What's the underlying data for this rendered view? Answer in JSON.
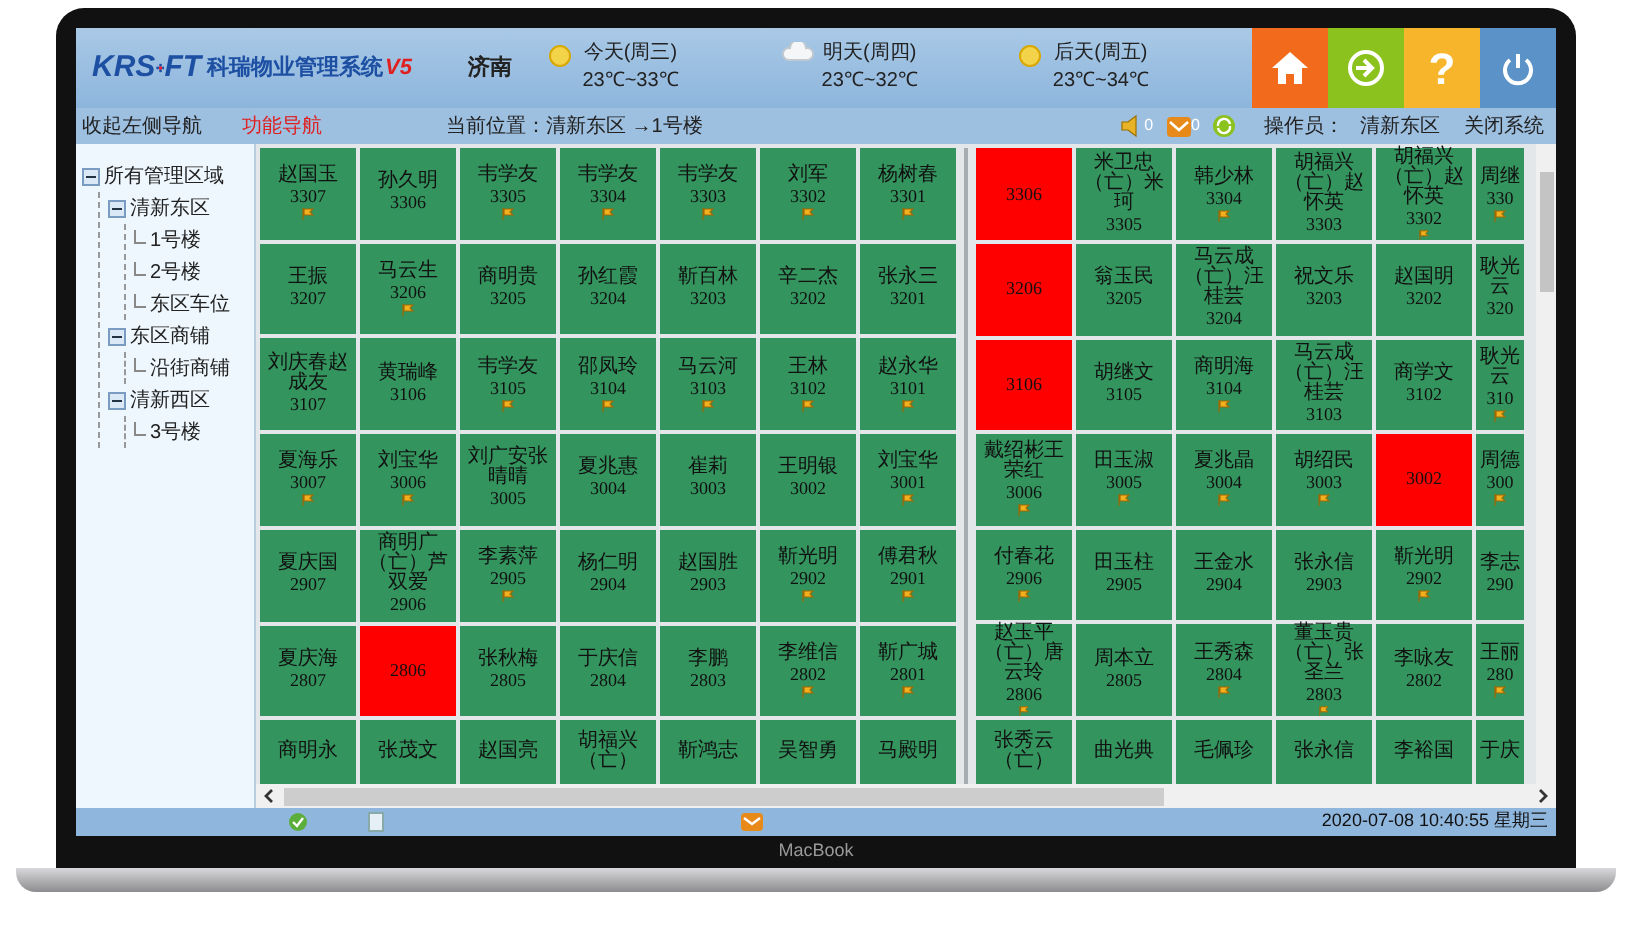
{
  "header": {
    "logo": {
      "letters_left": "KRS",
      "letters_right": "FT",
      "title": "科瑞物业管理系统",
      "version": "V5"
    },
    "city": "济南",
    "weather": [
      {
        "day": "今天(周三)",
        "temp": "23℃~33℃",
        "kind": "sunny"
      },
      {
        "day": "明天(周四)",
        "temp": "23℃~32℃",
        "kind": "cloudy"
      },
      {
        "day": "后天(周五)",
        "temp": "23℃~34℃",
        "kind": "sunny"
      }
    ],
    "buttons": [
      {
        "kind": "home"
      },
      {
        "kind": "login"
      },
      {
        "kind": "help",
        "label": "?"
      },
      {
        "kind": "power"
      }
    ]
  },
  "nav": {
    "collapse": "收起左侧导航",
    "function_nav": "功能导航",
    "location": "当前位置：清新东区 →1号楼",
    "alerts": [
      {
        "kind": "sound",
        "count": "0"
      },
      {
        "kind": "mail",
        "count": "0"
      },
      {
        "kind": "refresh"
      }
    ],
    "operator_label": "操作员：",
    "operator": "清新东区",
    "close": "关闭系统"
  },
  "tree": [
    {
      "label": "所有管理区域",
      "expanded": true,
      "children": [
        {
          "label": "清新东区",
          "expanded": true,
          "children": [
            {
              "label": "1号楼"
            },
            {
              "label": "2号楼"
            },
            {
              "label": "东区车位"
            }
          ]
        },
        {
          "label": "东区商铺",
          "expanded": true,
          "children": [
            {
              "label": "沿街商铺"
            }
          ]
        },
        {
          "label": "清新西区",
          "expanded": true,
          "children": [
            {
              "label": "3号楼"
            }
          ]
        }
      ]
    }
  ],
  "grid": {
    "blocks": [
      {
        "rows": [
          [
            {
              "name": "赵国玉",
              "number": "3307",
              "alert": false,
              "flag": true
            },
            {
              "name": "孙久明",
              "number": "3306",
              "alert": false,
              "flag": false
            },
            {
              "name": "韦学友",
              "number": "3305",
              "alert": false,
              "flag": true
            },
            {
              "name": "韦学友",
              "number": "3304",
              "alert": false,
              "flag": true
            },
            {
              "name": "韦学友",
              "number": "3303",
              "alert": false,
              "flag": true
            },
            {
              "name": "刘军",
              "number": "3302",
              "alert": false,
              "flag": true
            },
            {
              "name": "杨树春",
              "number": "3301",
              "alert": false,
              "flag": true
            }
          ],
          [
            {
              "name": "王振",
              "number": "3207",
              "alert": false,
              "flag": false
            },
            {
              "name": "马云生",
              "number": "3206",
              "alert": false,
              "flag": true
            },
            {
              "name": "商明贵",
              "number": "3205",
              "alert": false,
              "flag": false
            },
            {
              "name": "孙红霞",
              "number": "3204",
              "alert": false,
              "flag": false
            },
            {
              "name": "靳百林",
              "number": "3203",
              "alert": false,
              "flag": false
            },
            {
              "name": "辛二杰",
              "number": "3202",
              "alert": false,
              "flag": false
            },
            {
              "name": "张永三",
              "number": "3201",
              "alert": false,
              "flag": false
            }
          ],
          [
            {
              "name": "刘庆春赵成友",
              "number": "3107",
              "alert": false,
              "flag": false
            },
            {
              "name": "黄瑞峰",
              "number": "3106",
              "alert": false,
              "flag": false
            },
            {
              "name": "韦学友",
              "number": "3105",
              "alert": false,
              "flag": true
            },
            {
              "name": "邵凤玲",
              "number": "3104",
              "alert": false,
              "flag": true
            },
            {
              "name": "马云河",
              "number": "3103",
              "alert": false,
              "flag": true
            },
            {
              "name": "王林",
              "number": "3102",
              "alert": false,
              "flag": true
            },
            {
              "name": "赵永华",
              "number": "3101",
              "alert": false,
              "flag": true
            }
          ],
          [
            {
              "name": "夏海乐",
              "number": "3007",
              "alert": false,
              "flag": true
            },
            {
              "name": "刘宝华",
              "number": "3006",
              "alert": false,
              "flag": true
            },
            {
              "name": "刘广安张晴晴",
              "number": "3005",
              "alert": false,
              "flag": false
            },
            {
              "name": "夏兆惠",
              "number": "3004",
              "alert": false,
              "flag": false
            },
            {
              "name": "崔莉",
              "number": "3003",
              "alert": false,
              "flag": false
            },
            {
              "name": "王明银",
              "number": "3002",
              "alert": false,
              "flag": false
            },
            {
              "name": "刘宝华",
              "number": "3001",
              "alert": false,
              "flag": true
            }
          ],
          [
            {
              "name": "夏庆国",
              "number": "2907",
              "alert": false,
              "flag": false
            },
            {
              "name": "商明广（亡）芦双爱",
              "number": "2906",
              "alert": false,
              "flag": false
            },
            {
              "name": "李素萍",
              "number": "2905",
              "alert": false,
              "flag": true
            },
            {
              "name": "杨仁明",
              "number": "2904",
              "alert": false,
              "flag": false
            },
            {
              "name": "赵国胜",
              "number": "2903",
              "alert": false,
              "flag": false
            },
            {
              "name": "靳光明",
              "number": "2902",
              "alert": false,
              "flag": true
            },
            {
              "name": "傅君秋",
              "number": "2901",
              "alert": false,
              "flag": true
            }
          ],
          [
            {
              "name": "夏庆海",
              "number": "2807",
              "alert": false,
              "flag": false
            },
            {
              "number": "2806",
              "alert": true,
              "flag": false
            },
            {
              "name": "张秋梅",
              "number": "2805",
              "alert": false,
              "flag": false
            },
            {
              "name": "于庆信",
              "number": "2804",
              "alert": false,
              "flag": false
            },
            {
              "name": "李鹏",
              "number": "2803",
              "alert": false,
              "flag": false
            },
            {
              "name": "李维信",
              "number": "2802",
              "alert": false,
              "flag": true
            },
            {
              "name": "靳广城",
              "number": "2801",
              "alert": false,
              "flag": true
            }
          ],
          [
            {
              "name": "商明永",
              "alert": false,
              "flag": false
            },
            {
              "name": "张茂文",
              "alert": false,
              "flag": false
            },
            {
              "name": "赵国亮",
              "alert": false,
              "flag": false
            },
            {
              "name": "胡福兴（亡）",
              "alert": false,
              "flag": false
            },
            {
              "name": "靳鸿志",
              "alert": false,
              "flag": false
            },
            {
              "name": "吴智勇",
              "alert": false,
              "flag": false
            },
            {
              "name": "马殿明",
              "alert": false,
              "flag": false
            }
          ]
        ]
      },
      {
        "rows": [
          [
            {
              "kind": "full",
              "number": "3306",
              "alert": true,
              "flag": false
            },
            {
              "kind": "full",
              "name": "米卫忠（亡）米珂",
              "number": "3305",
              "alert": false,
              "flag": false
            },
            {
              "kind": "full",
              "name": "韩少林",
              "number": "3304",
              "alert": false,
              "flag": true
            },
            {
              "kind": "full",
              "name": "胡福兴（亡）赵怀英",
              "number": "3303",
              "alert": false,
              "flag": false
            },
            {
              "kind": "full",
              "name": "胡福兴（亡）赵怀英",
              "number": "3302",
              "alert": false,
              "flag": true
            },
            {
              "kind": "partial",
              "name": "周继",
              "number": "330",
              "alert": false,
              "flag": true
            }
          ],
          [
            {
              "kind": "full",
              "number": "3206",
              "alert": true,
              "flag": false
            },
            {
              "kind": "full",
              "name": "翁玉民",
              "number": "3205",
              "alert": false,
              "flag": false
            },
            {
              "kind": "full",
              "name": "马云成（亡）汪桂芸",
              "number": "3204",
              "alert": false,
              "flag": false
            },
            {
              "kind": "full",
              "name": "祝文乐",
              "number": "3203",
              "alert": false,
              "flag": false
            },
            {
              "kind": "full",
              "name": "赵国明",
              "number": "3202",
              "alert": false,
              "flag": false
            },
            {
              "kind": "partial",
              "name": "耿光云",
              "number": "320",
              "alert": false,
              "flag": false
            }
          ],
          [
            {
              "kind": "full",
              "number": "3106",
              "alert": true,
              "flag": false
            },
            {
              "kind": "full",
              "name": "胡继文",
              "number": "3105",
              "alert": false,
              "flag": false
            },
            {
              "kind": "full",
              "name": "商明海",
              "number": "3104",
              "alert": false,
              "flag": true
            },
            {
              "kind": "full",
              "name": "马云成（亡）汪桂芸",
              "number": "3103",
              "alert": false,
              "flag": false
            },
            {
              "kind": "full",
              "name": "商学文",
              "number": "3102",
              "alert": false,
              "flag": false
            },
            {
              "kind": "partial",
              "name": "耿光云",
              "number": "310",
              "alert": false,
              "flag": true
            }
          ],
          [
            {
              "kind": "full",
              "name": "戴绍彬王荣红",
              "number": "3006",
              "alert": false,
              "flag": true
            },
            {
              "kind": "full",
              "name": "田玉淑",
              "number": "3005",
              "alert": false,
              "flag": true
            },
            {
              "kind": "full",
              "name": "夏兆晶",
              "number": "3004",
              "alert": false,
              "flag": true
            },
            {
              "kind": "full",
              "name": "胡绍民",
              "number": "3003",
              "alert": false,
              "flag": true
            },
            {
              "kind": "full",
              "number": "3002",
              "alert": true,
              "flag": false
            },
            {
              "kind": "partial",
              "name": "周德",
              "number": "300",
              "alert": false,
              "flag": true
            }
          ],
          [
            {
              "kind": "full",
              "name": "付春花",
              "number": "2906",
              "alert": false,
              "flag": true
            },
            {
              "kind": "full",
              "name": "田玉柱",
              "number": "2905",
              "alert": false,
              "flag": false
            },
            {
              "kind": "full",
              "name": "王金水",
              "number": "2904",
              "alert": false,
              "flag": false
            },
            {
              "kind": "full",
              "name": "张永信",
              "number": "2903",
              "alert": false,
              "flag": false
            },
            {
              "kind": "full",
              "name": "靳光明",
              "number": "2902",
              "alert": false,
              "flag": true
            },
            {
              "kind": "partial",
              "name": "李志",
              "number": "290",
              "alert": false,
              "flag": false
            }
          ],
          [
            {
              "kind": "full",
              "name": "赵玉平（亡）唐云玲",
              "number": "2806",
              "alert": false,
              "flag": true
            },
            {
              "kind": "full",
              "name": "周本立",
              "number": "2805",
              "alert": false,
              "flag": false
            },
            {
              "kind": "full",
              "name": "王秀森",
              "number": "2804",
              "alert": false,
              "flag": true
            },
            {
              "kind": "full",
              "name": "董玉贵（亡）张圣兰",
              "number": "2803",
              "alert": false,
              "flag": true
            },
            {
              "kind": "full",
              "name": "李咏友",
              "number": "2802",
              "alert": false,
              "flag": false
            },
            {
              "kind": "partial",
              "name": "王丽",
              "number": "280",
              "alert": false,
              "flag": true
            }
          ],
          [
            {
              "kind": "full",
              "name": "张秀云（亡）",
              "alert": false,
              "flag": false
            },
            {
              "kind": "full",
              "name": "曲光典",
              "alert": false,
              "flag": false
            },
            {
              "kind": "full",
              "name": "毛佩珍",
              "alert": false,
              "flag": false
            },
            {
              "kind": "full",
              "name": "张永信",
              "alert": false,
              "flag": false
            },
            {
              "kind": "full",
              "name": "李裕国",
              "alert": false,
              "flag": false
            },
            {
              "kind": "partial",
              "name": "于庆",
              "alert": false,
              "flag": false
            }
          ]
        ]
      }
    ]
  },
  "status_bar": {
    "time": "2020-07-08 10:40:55 星期三"
  },
  "laptop": {
    "label": "MacBook"
  }
}
